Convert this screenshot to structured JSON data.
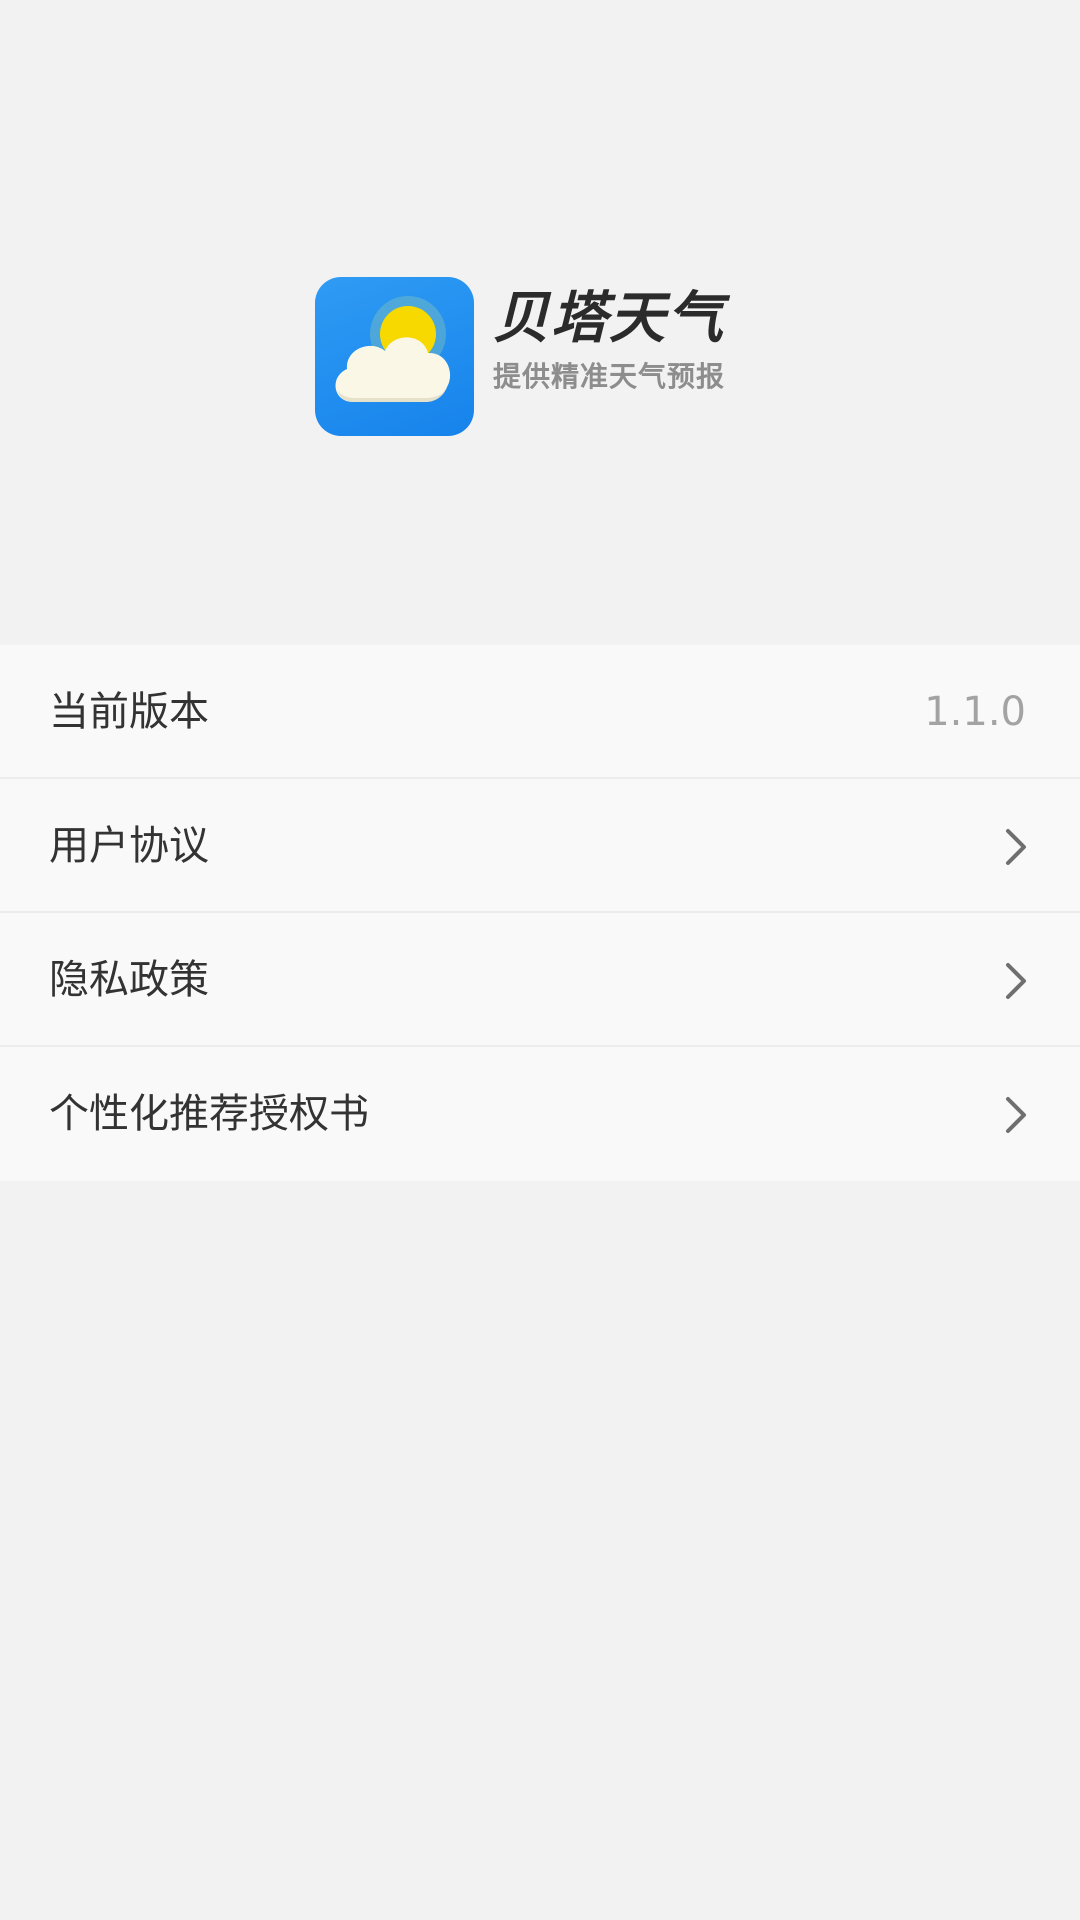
{
  "brand": {
    "name": "贝塔天气",
    "slogan": "提供精准天气预报",
    "colors": {
      "icon_background": "#1e8ff0",
      "sun": "#f7d900",
      "cloud": "#fbf7e6"
    }
  },
  "settings": {
    "version": {
      "label": "当前版本",
      "value": "1.1.0"
    },
    "items": [
      {
        "label": "用户协议",
        "icon": "chevron-right-icon"
      },
      {
        "label": "隐私政策",
        "icon": "chevron-right-icon"
      },
      {
        "label": "个性化推荐授权书",
        "icon": "chevron-right-icon"
      }
    ]
  }
}
